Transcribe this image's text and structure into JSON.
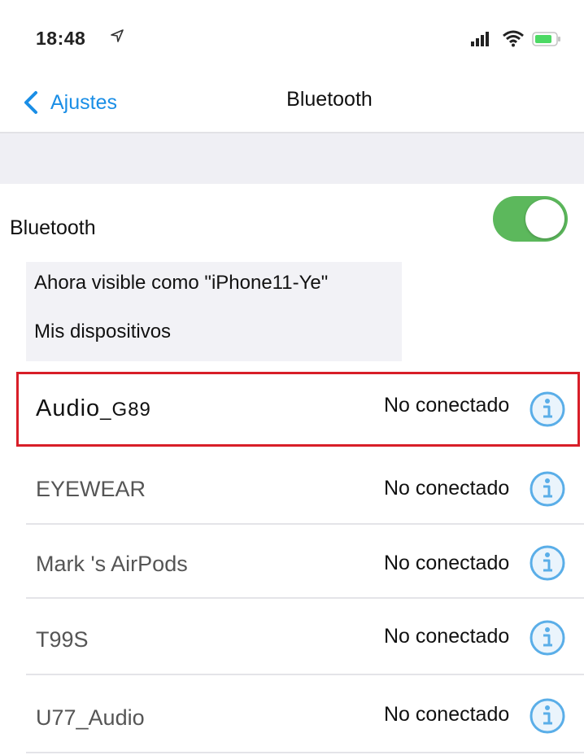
{
  "status_bar": {
    "time": "18:48",
    "location_icon": "location-arrow-icon",
    "signal_icon": "cellular-signal-icon",
    "wifi_icon": "wifi-icon",
    "battery_icon": "battery-icon"
  },
  "nav": {
    "back_label": "Ajustes",
    "title": "Bluetooth"
  },
  "bluetooth": {
    "label": "Bluetooth",
    "enabled": true
  },
  "visible_text": "Ahora visible como \"iPhone11-Ye\"",
  "section_header": "Mis dispositivos",
  "devices": [
    {
      "name_main": "Audio",
      "name_suffix": "_G89",
      "status": "No conectado",
      "highlighted": true
    },
    {
      "name": "EYEWEAR",
      "status": "No conectado"
    },
    {
      "name": "Mark 's AirPods",
      "status": "No conectado"
    },
    {
      "name": "T99S",
      "status": "No conectado"
    },
    {
      "name": "U77_Audio",
      "status": "No conectado"
    }
  ],
  "colors": {
    "accent": "#1a8ee6",
    "toggle_on": "#5cb85c",
    "highlight": "#d81e28",
    "info_icon": "#5aaee8"
  }
}
